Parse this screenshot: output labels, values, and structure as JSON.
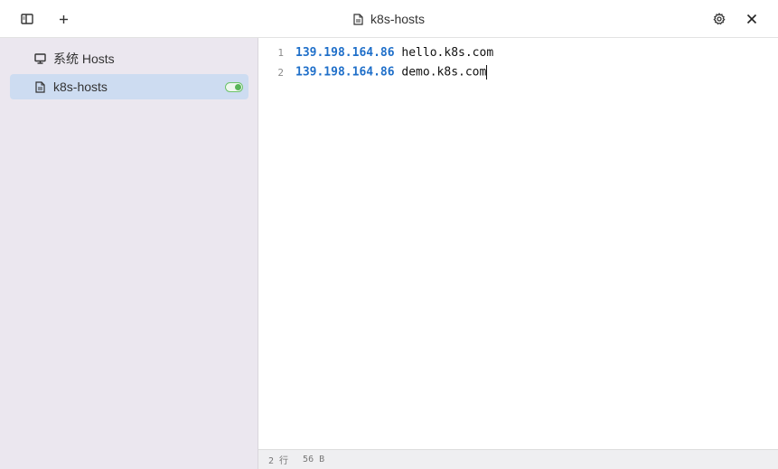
{
  "window": {
    "title": "k8s-hosts",
    "title_icon": "file-icon"
  },
  "toolbar": {
    "left_buttons": [
      {
        "icon": "sidebar-toggle-icon"
      },
      {
        "icon": "plus-icon",
        "label": "+"
      }
    ],
    "right_buttons": [
      {
        "icon": "gear-icon"
      },
      {
        "icon": "close-icon",
        "label": "✕"
      }
    ]
  },
  "sidebar": {
    "items": [
      {
        "label": "系统 Hosts",
        "icon": "monitor-icon",
        "active": false
      },
      {
        "label": "k8s-hosts",
        "icon": "file-icon",
        "active": true,
        "enabled": true
      }
    ]
  },
  "editor": {
    "lines": [
      {
        "number": "1",
        "ip": "139.198.164.86",
        "host": " hello.k8s.com"
      },
      {
        "number": "2",
        "ip": "139.198.164.86",
        "host": " demo.k8s.com"
      }
    ]
  },
  "statusbar": {
    "lines_text": "2 行",
    "size_text": "56 B"
  },
  "colors": {
    "sidebar_bg": "#ebe7ef",
    "active_item_bg": "#cddcf1",
    "ip_color": "#1f6fc9",
    "toggle_on": "#58b558"
  }
}
